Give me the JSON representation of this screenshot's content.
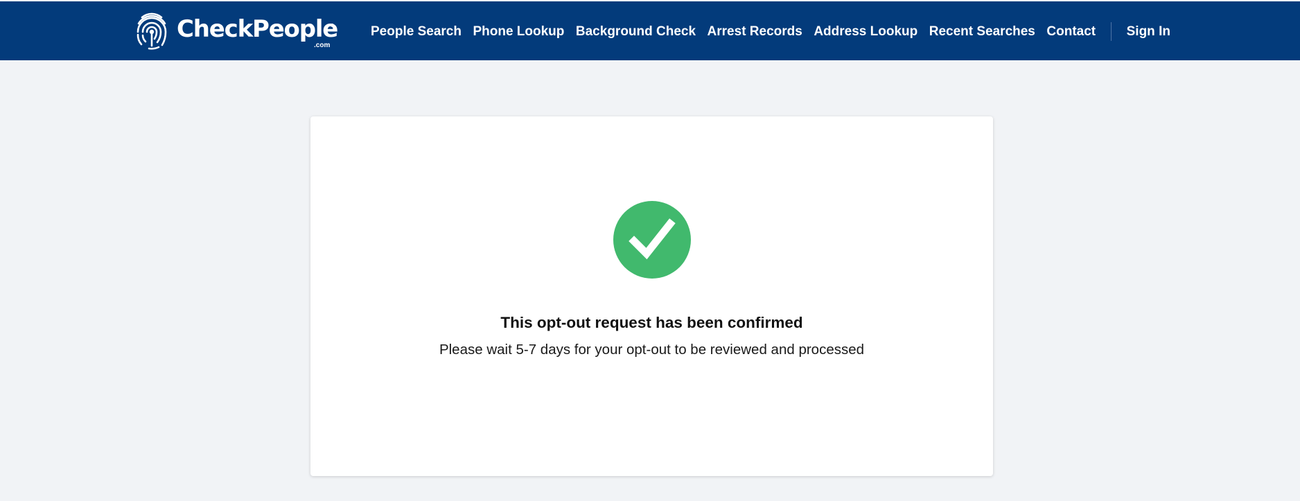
{
  "brand": {
    "name": "CheckPeople",
    "domain_suffix": ".com",
    "logo_icon": "fingerprint-icon",
    "header_color": "#033b7b"
  },
  "nav": {
    "items": [
      {
        "label": "People Search"
      },
      {
        "label": "Phone Lookup"
      },
      {
        "label": "Background Check"
      },
      {
        "label": "Arrest Records"
      },
      {
        "label": "Address Lookup"
      },
      {
        "label": "Recent Searches"
      },
      {
        "label": "Contact"
      }
    ],
    "sign_in_label": "Sign In"
  },
  "confirmation": {
    "icon": "checkmark-circle-icon",
    "icon_color": "#41b96d",
    "title": "This opt-out request has been confirmed",
    "message": "Please wait 5-7 days for your opt-out to be reviewed and processed"
  }
}
